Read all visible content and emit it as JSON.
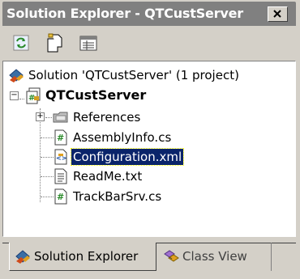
{
  "window": {
    "title": "Solution Explorer - QTCustServer"
  },
  "toolbar": {
    "buttons": [
      {
        "name": "refresh",
        "icon": "refresh-icon"
      },
      {
        "name": "show-all-files",
        "icon": "show-all-files-icon"
      },
      {
        "name": "properties",
        "icon": "properties-icon"
      }
    ]
  },
  "tree": {
    "solution": {
      "label": "Solution 'QTCustServer' (1 project)",
      "icon": "solution-icon"
    },
    "project": {
      "label": "QTCustServer",
      "icon": "csharp-project-icon",
      "expanded": true
    },
    "items": [
      {
        "label": "References",
        "icon": "references-folder-icon",
        "expandable": true,
        "expanded": false,
        "selected": false
      },
      {
        "label": "AssemblyInfo.cs",
        "icon": "csharp-file-icon",
        "selected": false
      },
      {
        "label": "Configuration.xml",
        "icon": "xml-file-icon",
        "selected": true
      },
      {
        "label": "ReadMe.txt",
        "icon": "text-file-icon",
        "selected": false
      },
      {
        "label": "TrackBarSrv.cs",
        "icon": "csharp-file-icon",
        "selected": false
      }
    ],
    "expander_minus": "−",
    "expander_plus": "+"
  },
  "tabs": [
    {
      "label": "Solution Explorer",
      "icon": "solution-icon",
      "active": true
    },
    {
      "label": "Class View",
      "icon": "class-view-icon",
      "active": false
    }
  ],
  "colors": {
    "titlebar_inactive": "#808080",
    "selection": "#0a246a",
    "chrome": "#d4d0c8"
  }
}
